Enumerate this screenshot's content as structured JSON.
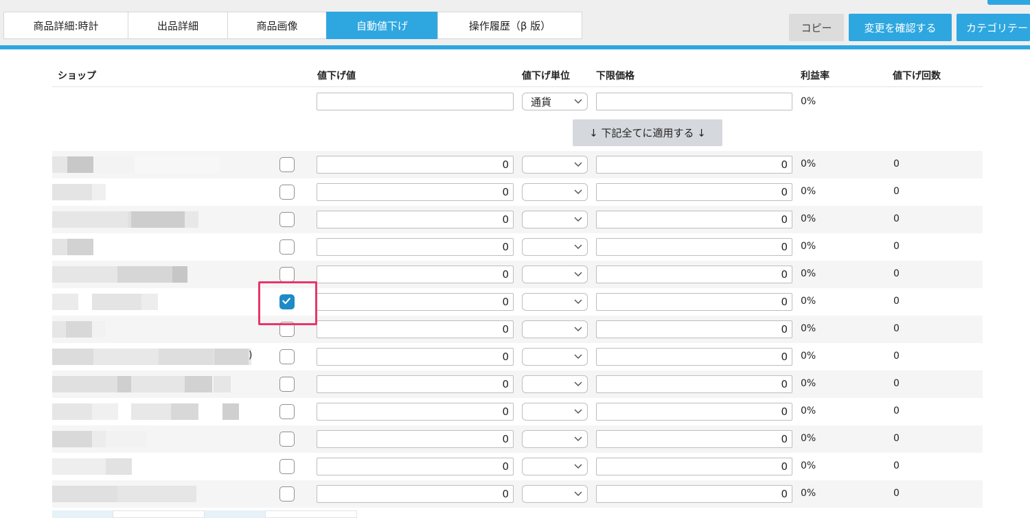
{
  "tabs": [
    {
      "label": "商品詳細:時計",
      "active": false
    },
    {
      "label": "出品詳細",
      "active": false
    },
    {
      "label": "商品画像",
      "active": false
    },
    {
      "label": "自動値下げ",
      "active": true
    },
    {
      "label": "操作履歴（β 版）",
      "active": false
    }
  ],
  "actions": {
    "copy": "コピー",
    "confirm": "変更を確認する",
    "category": "カテゴリテー"
  },
  "table": {
    "headers": {
      "shop": "ショップ",
      "discount_value": "値下げ値",
      "discount_unit": "値下げ単位",
      "min_price": "下限価格",
      "profit_rate": "利益率",
      "discount_count": "値下げ回数"
    },
    "bulk": {
      "unit_selected": "通貨",
      "profit_rate": "0%",
      "apply_label": "↓ 下記全てに適用する ↓"
    },
    "rows": [
      {
        "checked": false,
        "discount_value": "0",
        "min_price": "0",
        "profit_rate": "0%",
        "count": "0"
      },
      {
        "checked": false,
        "discount_value": "0",
        "min_price": "0",
        "profit_rate": "0%",
        "count": "0"
      },
      {
        "checked": false,
        "discount_value": "0",
        "min_price": "0",
        "profit_rate": "0%",
        "count": "0"
      },
      {
        "checked": false,
        "discount_value": "0",
        "min_price": "0",
        "profit_rate": "0%",
        "count": "0"
      },
      {
        "checked": false,
        "discount_value": "0",
        "min_price": "0",
        "profit_rate": "0%",
        "count": "0"
      },
      {
        "checked": true,
        "discount_value": "0",
        "min_price": "0",
        "profit_rate": "0%",
        "count": "0"
      },
      {
        "checked": false,
        "discount_value": "0",
        "min_price": "0",
        "profit_rate": "0%",
        "count": "0"
      },
      {
        "checked": false,
        "discount_value": "0",
        "min_price": "0",
        "profit_rate": "0%",
        "count": "0",
        "shop_suffix": ")"
      },
      {
        "checked": false,
        "discount_value": "0",
        "min_price": "0",
        "profit_rate": "0%",
        "count": "0"
      },
      {
        "checked": false,
        "discount_value": "0",
        "min_price": "0",
        "profit_rate": "0%",
        "count": "0"
      },
      {
        "checked": false,
        "discount_value": "0",
        "min_price": "0",
        "profit_rate": "0%",
        "count": "0"
      },
      {
        "checked": false,
        "discount_value": "0",
        "min_price": "0",
        "profit_rate": "0%",
        "count": "0"
      },
      {
        "checked": false,
        "discount_value": "0",
        "min_price": "0",
        "profit_rate": "0%",
        "count": "0"
      }
    ]
  },
  "colors": {
    "accent": "#2ea7e0",
    "checked": "#1f8bc5",
    "highlight": "#e8356b"
  }
}
